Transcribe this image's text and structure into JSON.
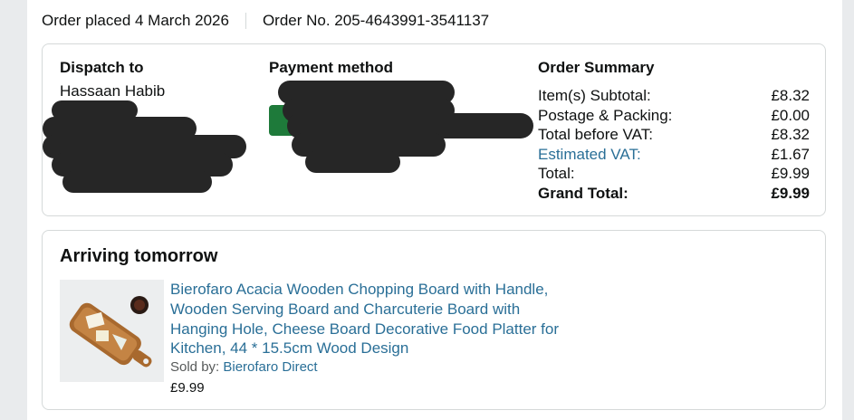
{
  "order": {
    "placed": "Order placed 4 March 2026",
    "number": "Order No. 205-4643991-3541137"
  },
  "dispatch": {
    "heading": "Dispatch to",
    "name": "Hassaan Habib"
  },
  "payment": {
    "heading": "Payment method"
  },
  "summary": {
    "heading": "Order Summary",
    "rows": [
      {
        "label": "Item(s) Subtotal:",
        "value": "£8.32"
      },
      {
        "label": "Postage & Packing:",
        "value": "£0.00"
      },
      {
        "label": "Total before VAT:",
        "value": "£8.32"
      },
      {
        "label": "Estimated VAT:",
        "value": "£1.67"
      },
      {
        "label": "Total:",
        "value": "£9.99"
      },
      {
        "label": "Grand Total:",
        "value": "£9.99"
      }
    ]
  },
  "shipment": {
    "heading": "Arriving tomorrow",
    "item": {
      "title": "Bierofaro Acacia Wooden Chopping Board with Handle, Wooden Serving Board and Charcuterie Board with Hanging Hole, Cheese Board Decorative Food Platter for Kitchen, 44 * 15.5cm Wood Design",
      "sold_by_label": "Sold by:",
      "seller": "Bierofaro Direct",
      "price": "£9.99"
    }
  },
  "colors": {
    "link": "#2a6f97",
    "redaction": "#262626",
    "border": "#d5d9d9"
  }
}
